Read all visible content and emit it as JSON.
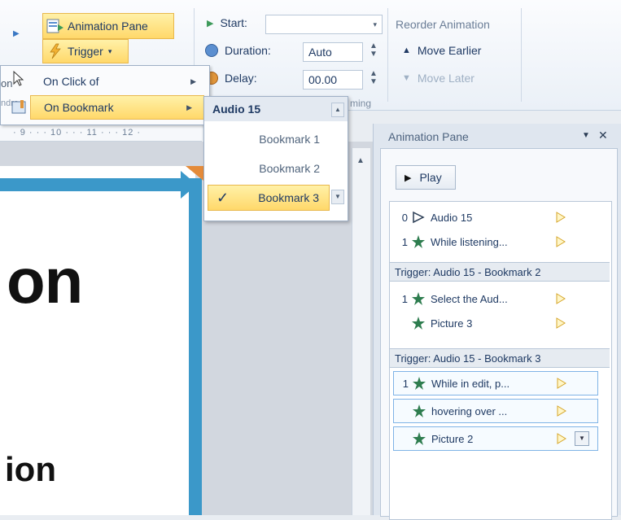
{
  "ribbon": {
    "animation_pane_label": "Animation Pane",
    "trigger_label": "Trigger",
    "left_cut_label": "on",
    "left_cut_label2": "ndra",
    "start_label": "Start:",
    "start_value": "",
    "duration_label": "Duration:",
    "duration_value": "Auto",
    "delay_label": "Delay:",
    "delay_value": "00.00",
    "timing_caption": "ming",
    "reorder_title": "Reorder Animation",
    "move_earlier_label": "Move Earlier",
    "move_later_label": "Move Later"
  },
  "ruler": {
    "text": "· 9 · · · 10 · · · 11 · · · 12 ·"
  },
  "trigger_menu": {
    "items": [
      {
        "label": "On Click of"
      },
      {
        "label": "On Bookmark"
      }
    ]
  },
  "bookmark_menu": {
    "header": "Audio 15",
    "items": [
      {
        "label": "Bookmark 1",
        "checked": false
      },
      {
        "label": "Bookmark 2",
        "checked": false
      },
      {
        "label": "Bookmark 3",
        "checked": true
      }
    ],
    "check_glyph": "✓"
  },
  "slide": {
    "big_text": "on",
    "small_text": "ion"
  },
  "animation_pane": {
    "title": "Animation Pane",
    "play_label": "Play",
    "rows": [
      {
        "num": "0",
        "label": "Audio 15",
        "icon": "play-audio-icon"
      },
      {
        "num": "1",
        "label": "While listening...",
        "icon": "effect-star-icon"
      }
    ],
    "trigger1": "Trigger: Audio 15 - Bookmark 2",
    "rows2": [
      {
        "num": "1",
        "label": "Select the Aud...",
        "icon": "effect-star-icon"
      },
      {
        "num": "",
        "label": "Picture 3",
        "icon": "effect-star-icon"
      }
    ],
    "trigger2": "Trigger: Audio 15 - Bookmark 3",
    "rows3": [
      {
        "num": "1",
        "label": "While in edit, p...",
        "icon": "effect-star-icon"
      },
      {
        "num": "",
        "label": "hovering over ...",
        "icon": "effect-star-icon"
      },
      {
        "num": "",
        "label": "Picture 2",
        "icon": "effect-star-icon"
      }
    ]
  },
  "colors": {
    "highlight": "#ffd86a",
    "slide_border": "#3b98c9",
    "accent_orange": "#e48b3a",
    "effect_green": "#2e7d4f"
  }
}
